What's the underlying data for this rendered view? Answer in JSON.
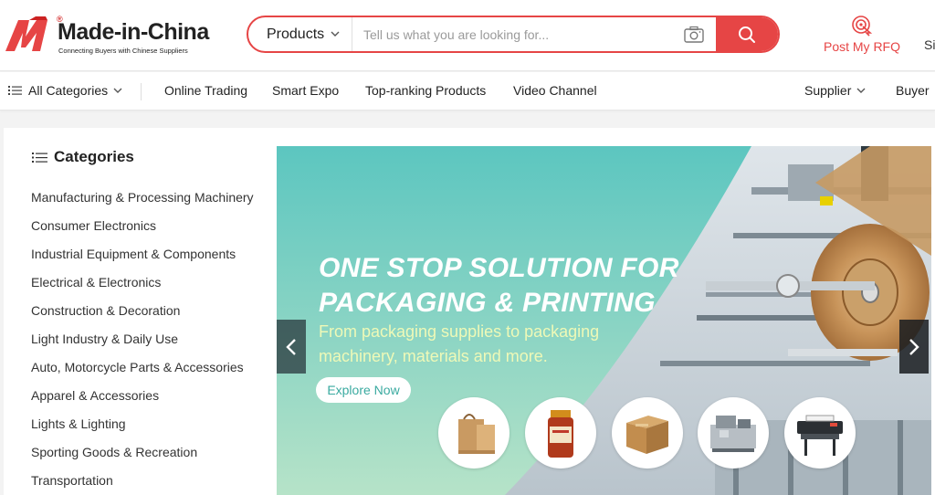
{
  "brand": {
    "name": "Made-in-China",
    "tagline": "Connecting Buyers with Chinese Suppliers",
    "registered": "®",
    "color": "#e64545"
  },
  "search": {
    "category": "Products",
    "placeholder": "Tell us what you are looking for...",
    "icons": [
      "camera-icon",
      "search-icon",
      "chevron-down-icon"
    ]
  },
  "header": {
    "rfq_label": "Post My RFQ",
    "signin_label": "Si"
  },
  "nav": {
    "all_categories": "All Categories",
    "items": [
      "Online Trading",
      "Smart Expo",
      "Top-ranking Products",
      "Video Channel"
    ],
    "supplier": "Supplier",
    "buyer": "Buyer"
  },
  "categories": {
    "title": "Categories",
    "items": [
      "Manufacturing & Processing Machinery",
      "Consumer Electronics",
      "Industrial Equipment & Components",
      "Electrical & Electronics",
      "Construction & Decoration",
      "Light Industry & Daily Use",
      "Auto, Motorcycle Parts & Accessories",
      "Apparel & Accessories",
      "Lights & Lighting",
      "Sporting Goods & Recreation",
      "Transportation"
    ]
  },
  "banner": {
    "headline_1": "ONE STOP SOLUTION FOR",
    "headline_2": "PACKAGING & PRINTING",
    "subtitle": "From packaging supplies to packaging machinery, materials and more.",
    "cta": "Explore Now",
    "product_thumbnails": [
      "paper-bag-icon",
      "jar-icon",
      "carton-box-icon",
      "packaging-machine-icon",
      "printer-icon"
    ]
  }
}
